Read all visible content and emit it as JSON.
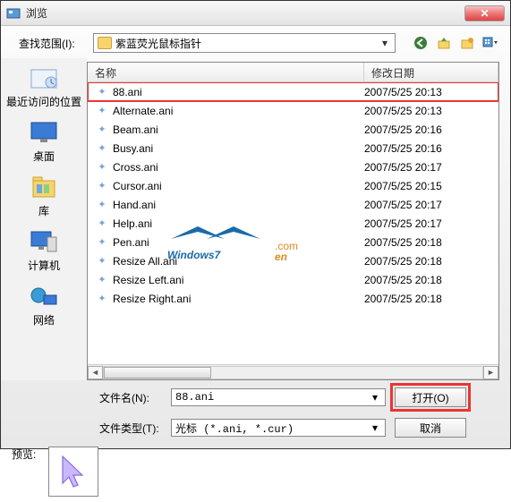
{
  "title": "浏览",
  "lookin_label": "查找范围(I):",
  "lookin_value": "紫蓝荧光鼠标指针",
  "sidebar": {
    "items": [
      {
        "label": "最近访问的位置"
      },
      {
        "label": "桌面"
      },
      {
        "label": "库"
      },
      {
        "label": "计算机"
      },
      {
        "label": "网络"
      }
    ]
  },
  "columns": {
    "name": "名称",
    "date": "修改日期"
  },
  "files": [
    {
      "name": "88.ani",
      "date": "2007/5/25 20:13"
    },
    {
      "name": "Alternate.ani",
      "date": "2007/5/25 20:13"
    },
    {
      "name": "Beam.ani",
      "date": "2007/5/25 20:16"
    },
    {
      "name": "Busy.ani",
      "date": "2007/5/25 20:16"
    },
    {
      "name": "Cross.ani",
      "date": "2007/5/25 20:17"
    },
    {
      "name": "Cursor.ani",
      "date": "2007/5/25 20:15"
    },
    {
      "name": "Hand.ani",
      "date": "2007/5/25 20:17"
    },
    {
      "name": "Help.ani",
      "date": "2007/5/25 20:17"
    },
    {
      "name": "Pen.ani",
      "date": "2007/5/25 20:18"
    },
    {
      "name": "Resize All.ani",
      "date": "2007/5/25 20:18"
    },
    {
      "name": "Resize Left.ani",
      "date": "2007/5/25 20:18"
    },
    {
      "name": "Resize Right.ani",
      "date": "2007/5/25 20:18"
    }
  ],
  "filename_label": "文件名(N):",
  "filename_value": "88.ani",
  "filetype_label": "文件类型(T):",
  "filetype_value": "光标 (*.ani, *.cur)",
  "open_btn": "打开(O)",
  "cancel_btn": "取消",
  "preview_label": "预览:",
  "watermark_text": "Windows7en.com"
}
